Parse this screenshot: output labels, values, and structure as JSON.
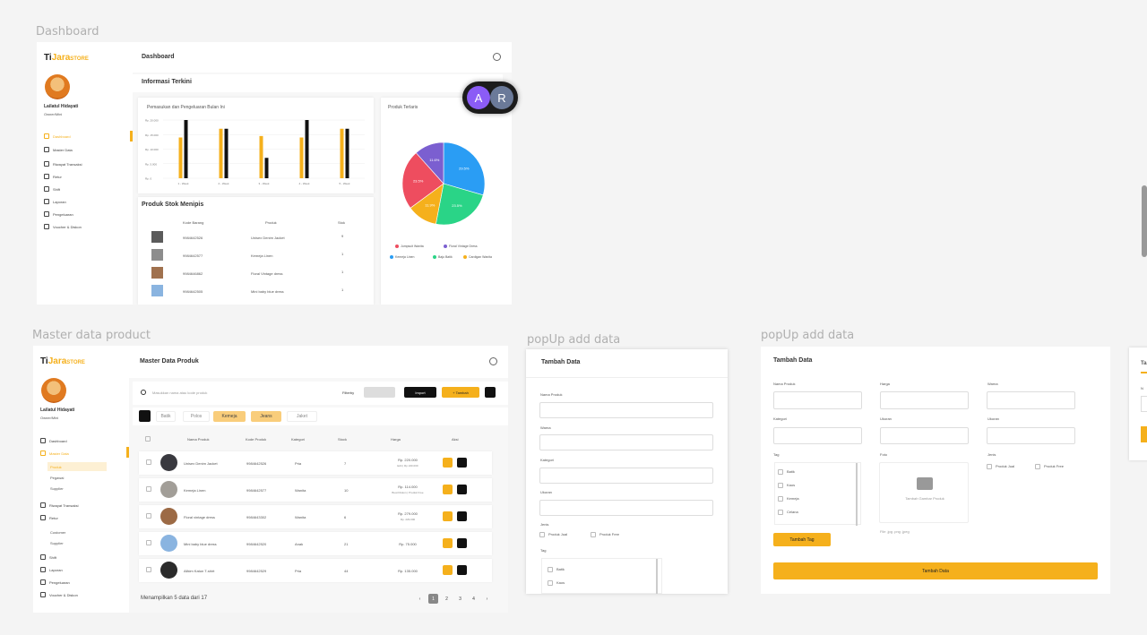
{
  "frames": {
    "dashboard": "Dashboard",
    "master": "Master data product",
    "popup1": "popUp add data",
    "popup2": "popUp add data"
  },
  "brand": {
    "prefix": "Ti",
    "mid": "Jara",
    "suffix": "STORE"
  },
  "user": {
    "name": "Lailatul Hidayati",
    "role": "Owner/Mini"
  },
  "dashboard": {
    "header": "Dashboard",
    "section": "Informasi Terkini",
    "nav": [
      "Dashboard",
      "Master Data",
      "Riwayat Transaksi",
      "Retur",
      "Shift",
      "Laporan",
      "Pengeluaran",
      "Voucher & Diskon"
    ],
    "bar_title": "Pemasukan dan Pengeluaran Bulan Ini",
    "pie_title": "Produk Terlaris",
    "low_stock_title": "Produk Stok Menipis",
    "low_stock_cols": [
      "Kode Barang",
      "Produk",
      "Stok"
    ],
    "low_stock_rows": [
      {
        "code": "9984642526",
        "name": "Unisex Denim Jacket",
        "stock": "9"
      },
      {
        "code": "9984642577",
        "name": "Kemeja Linen",
        "stock": "1"
      },
      {
        "code": "9984646862",
        "name": "Floral Vintage dress",
        "stock": "1"
      },
      {
        "code": "9984642505",
        "name": "Mini baby blue dress",
        "stock": "1"
      }
    ],
    "collab": [
      "A",
      "R"
    ]
  },
  "chart_data": [
    {
      "type": "bar",
      "title": "Pemasukan dan Pengeluaran Bulan Ini",
      "categories": [
        "1 - Week",
        "2 - Week",
        "3 - Week",
        "4 - Week",
        "5 - Week"
      ],
      "ytick_labels": [
        "Rp. 20.000",
        "Rp. 15.000",
        "Rp. 10.000",
        "Rp. 5.000",
        "Rp. 0"
      ],
      "ylim": [
        0,
        20000
      ],
      "series": [
        {
          "color": "#f5b01c",
          "values": [
            14000,
            17000,
            14500,
            14000,
            17000
          ]
        },
        {
          "color": "#111111",
          "values": [
            20000,
            17000,
            7000,
            20000,
            17000
          ]
        }
      ],
      "grid": true
    },
    {
      "type": "pie",
      "title": "Produk Terlaris",
      "labels": [
        "Jumpsuit Wanita",
        "Floral Vintage Dress",
        "Kemeja Linen",
        "Baju Batik",
        "Cardigan Wanita"
      ],
      "values": [
        23.5,
        11.6,
        29.5,
        23.5,
        11.9
      ],
      "colors": [
        "#ee4d5f",
        "#7b5fd0",
        "#2a9df4",
        "#2ad487",
        "#f5b01c"
      ],
      "data_labels": [
        "23.5%",
        "11.6%",
        "29.5%",
        "23.5%",
        "11.9%"
      ],
      "legend": "bottom"
    }
  ],
  "master": {
    "header": "Master Data Produk",
    "search_placeholder": "Masukkan nama atau kode produk",
    "filter_label": "Filterby",
    "import_label": "Import",
    "add_label": "+ Tambah",
    "nav": [
      "Dashboard",
      "Master Data",
      "Produk",
      "Pegawai",
      "Supplier",
      "Riwayat Transaksi",
      "Retur",
      "Customer",
      "Supplier",
      "Shift",
      "Laporan",
      "Pengeluaran",
      "Voucher & Diskon"
    ],
    "chips": [
      "Batik",
      "Polos",
      "Kemeja",
      "Jeans",
      "Jaket"
    ],
    "cols": [
      "Nama Produk",
      "Kode Produk",
      "Kategori",
      "Stock",
      "Harga",
      "Aksi"
    ],
    "rows": [
      {
        "name": "Unisex Denim Jacket",
        "code": "9984642526",
        "cat": "Pria",
        "stock": "7",
        "price": "Rp. 220.000",
        "sub": "Edit | Rp 240.000",
        "thumb": "#39393f"
      },
      {
        "name": "Kemeja Linen",
        "code": "9984642577",
        "cat": "Wanita",
        "stock": "10",
        "price": "Rp. 114.000",
        "sub": "Buat Diskon | Produk Free",
        "thumb": "#a29e98"
      },
      {
        "name": "Floral vintage dress",
        "code": "9984643302",
        "cat": "Wanita",
        "stock": "6",
        "price": "Rp. 279.000",
        "sub": "Rp. 229.000",
        "thumb": "#9c6a45"
      },
      {
        "name": "Mini baby blue dress",
        "code": "9984642520",
        "cat": "Anak",
        "stock": "21",
        "price": "Rp. 75.000",
        "sub": "",
        "thumb": "#8ab4e0"
      },
      {
        "name": "Allkim Katun T-shirt",
        "code": "9984642529",
        "cat": "Pria",
        "stock": "44",
        "price": "Rp. 135.000",
        "sub": "",
        "thumb": "#2b2b2b"
      }
    ],
    "footer": "Menampilkan 5 data dari 17",
    "pages": [
      "‹",
      "1",
      "2",
      "3",
      "4",
      "›"
    ]
  },
  "popup1": {
    "title": "Tambah Data",
    "labels": [
      "Nama Produk",
      "Warna",
      "Kategori",
      "Ukuran"
    ],
    "jenis": "Jenis",
    "jenis_opts": [
      "Produk Jual",
      "Produk Free"
    ],
    "tag": "Tag",
    "tags": [
      "Batik",
      "Kaos"
    ]
  },
  "popup2": {
    "title": "Tambah Data",
    "labels": [
      "Nama Produk",
      "Harga",
      "Warna",
      "Kategori",
      "Ukuran",
      "Ukuran"
    ],
    "tag": "Tag",
    "tags": [
      "Batik",
      "Kaos",
      "Kemeja",
      "Celana"
    ],
    "foto": "Foto",
    "upload": "Tambah Gambar Produk",
    "formats": "File .jpg .png .jpeg",
    "jenis": "Jenis",
    "jenis_opts": [
      "Produk Jual",
      "Produk Free"
    ],
    "add_tag": "Tambah Tag",
    "submit": "Tambah Data"
  },
  "partial": {
    "title": "Ta",
    "label": "N"
  }
}
